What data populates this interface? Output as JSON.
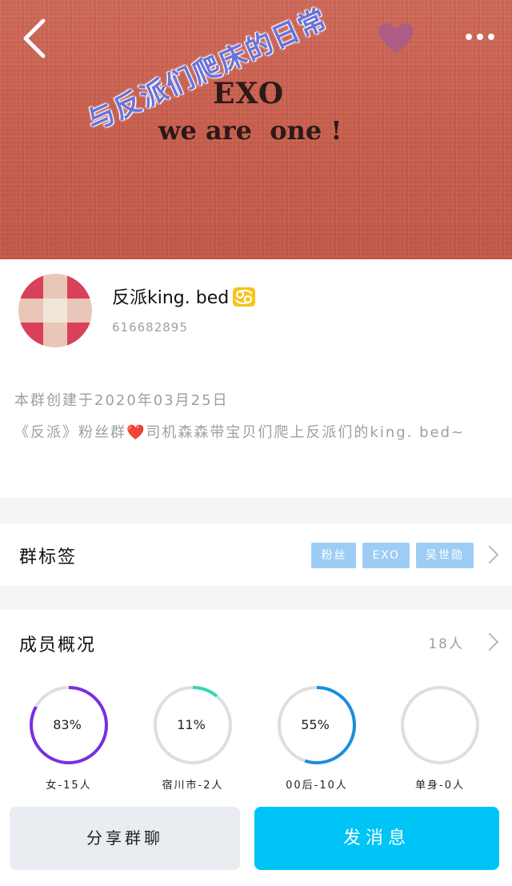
{
  "banner": {
    "title": "EXO",
    "subtitle": "we are  one !",
    "overlay_text": "与反派们爬床的日常"
  },
  "header": {
    "back_icon": "back-arrow-icon",
    "more_icon": "more-dots-icon"
  },
  "profile": {
    "name": "反派king. bed",
    "zodiac_icon": "cancer-zodiac-icon",
    "id": "616682895",
    "created": "本群创建于2020年03月25日",
    "desc_before": "《反派》粉丝群",
    "desc_after": "司机森森带宝贝们爬上反派们的king. bed~",
    "desc_heart": "❤️"
  },
  "tags": {
    "label": "群标签",
    "items": [
      "粉丝",
      "EXO",
      "吴世勋"
    ]
  },
  "members": {
    "label": "成员概况",
    "count": "18人",
    "stats": [
      {
        "value": "83%",
        "label": "女-15人",
        "percent": 83,
        "color": "#7b2ee0"
      },
      {
        "value": "11%",
        "label": "宿川市-2人",
        "percent": 11,
        "color": "#33d6b4"
      },
      {
        "value": "55%",
        "label": "00后-10人",
        "percent": 55,
        "color": "#1a8de0"
      },
      {
        "value": "",
        "label": "单身-0人",
        "percent": 0,
        "color": "#cccccc"
      }
    ]
  },
  "buttons": {
    "share": "分享群聊",
    "send": "发消息"
  }
}
